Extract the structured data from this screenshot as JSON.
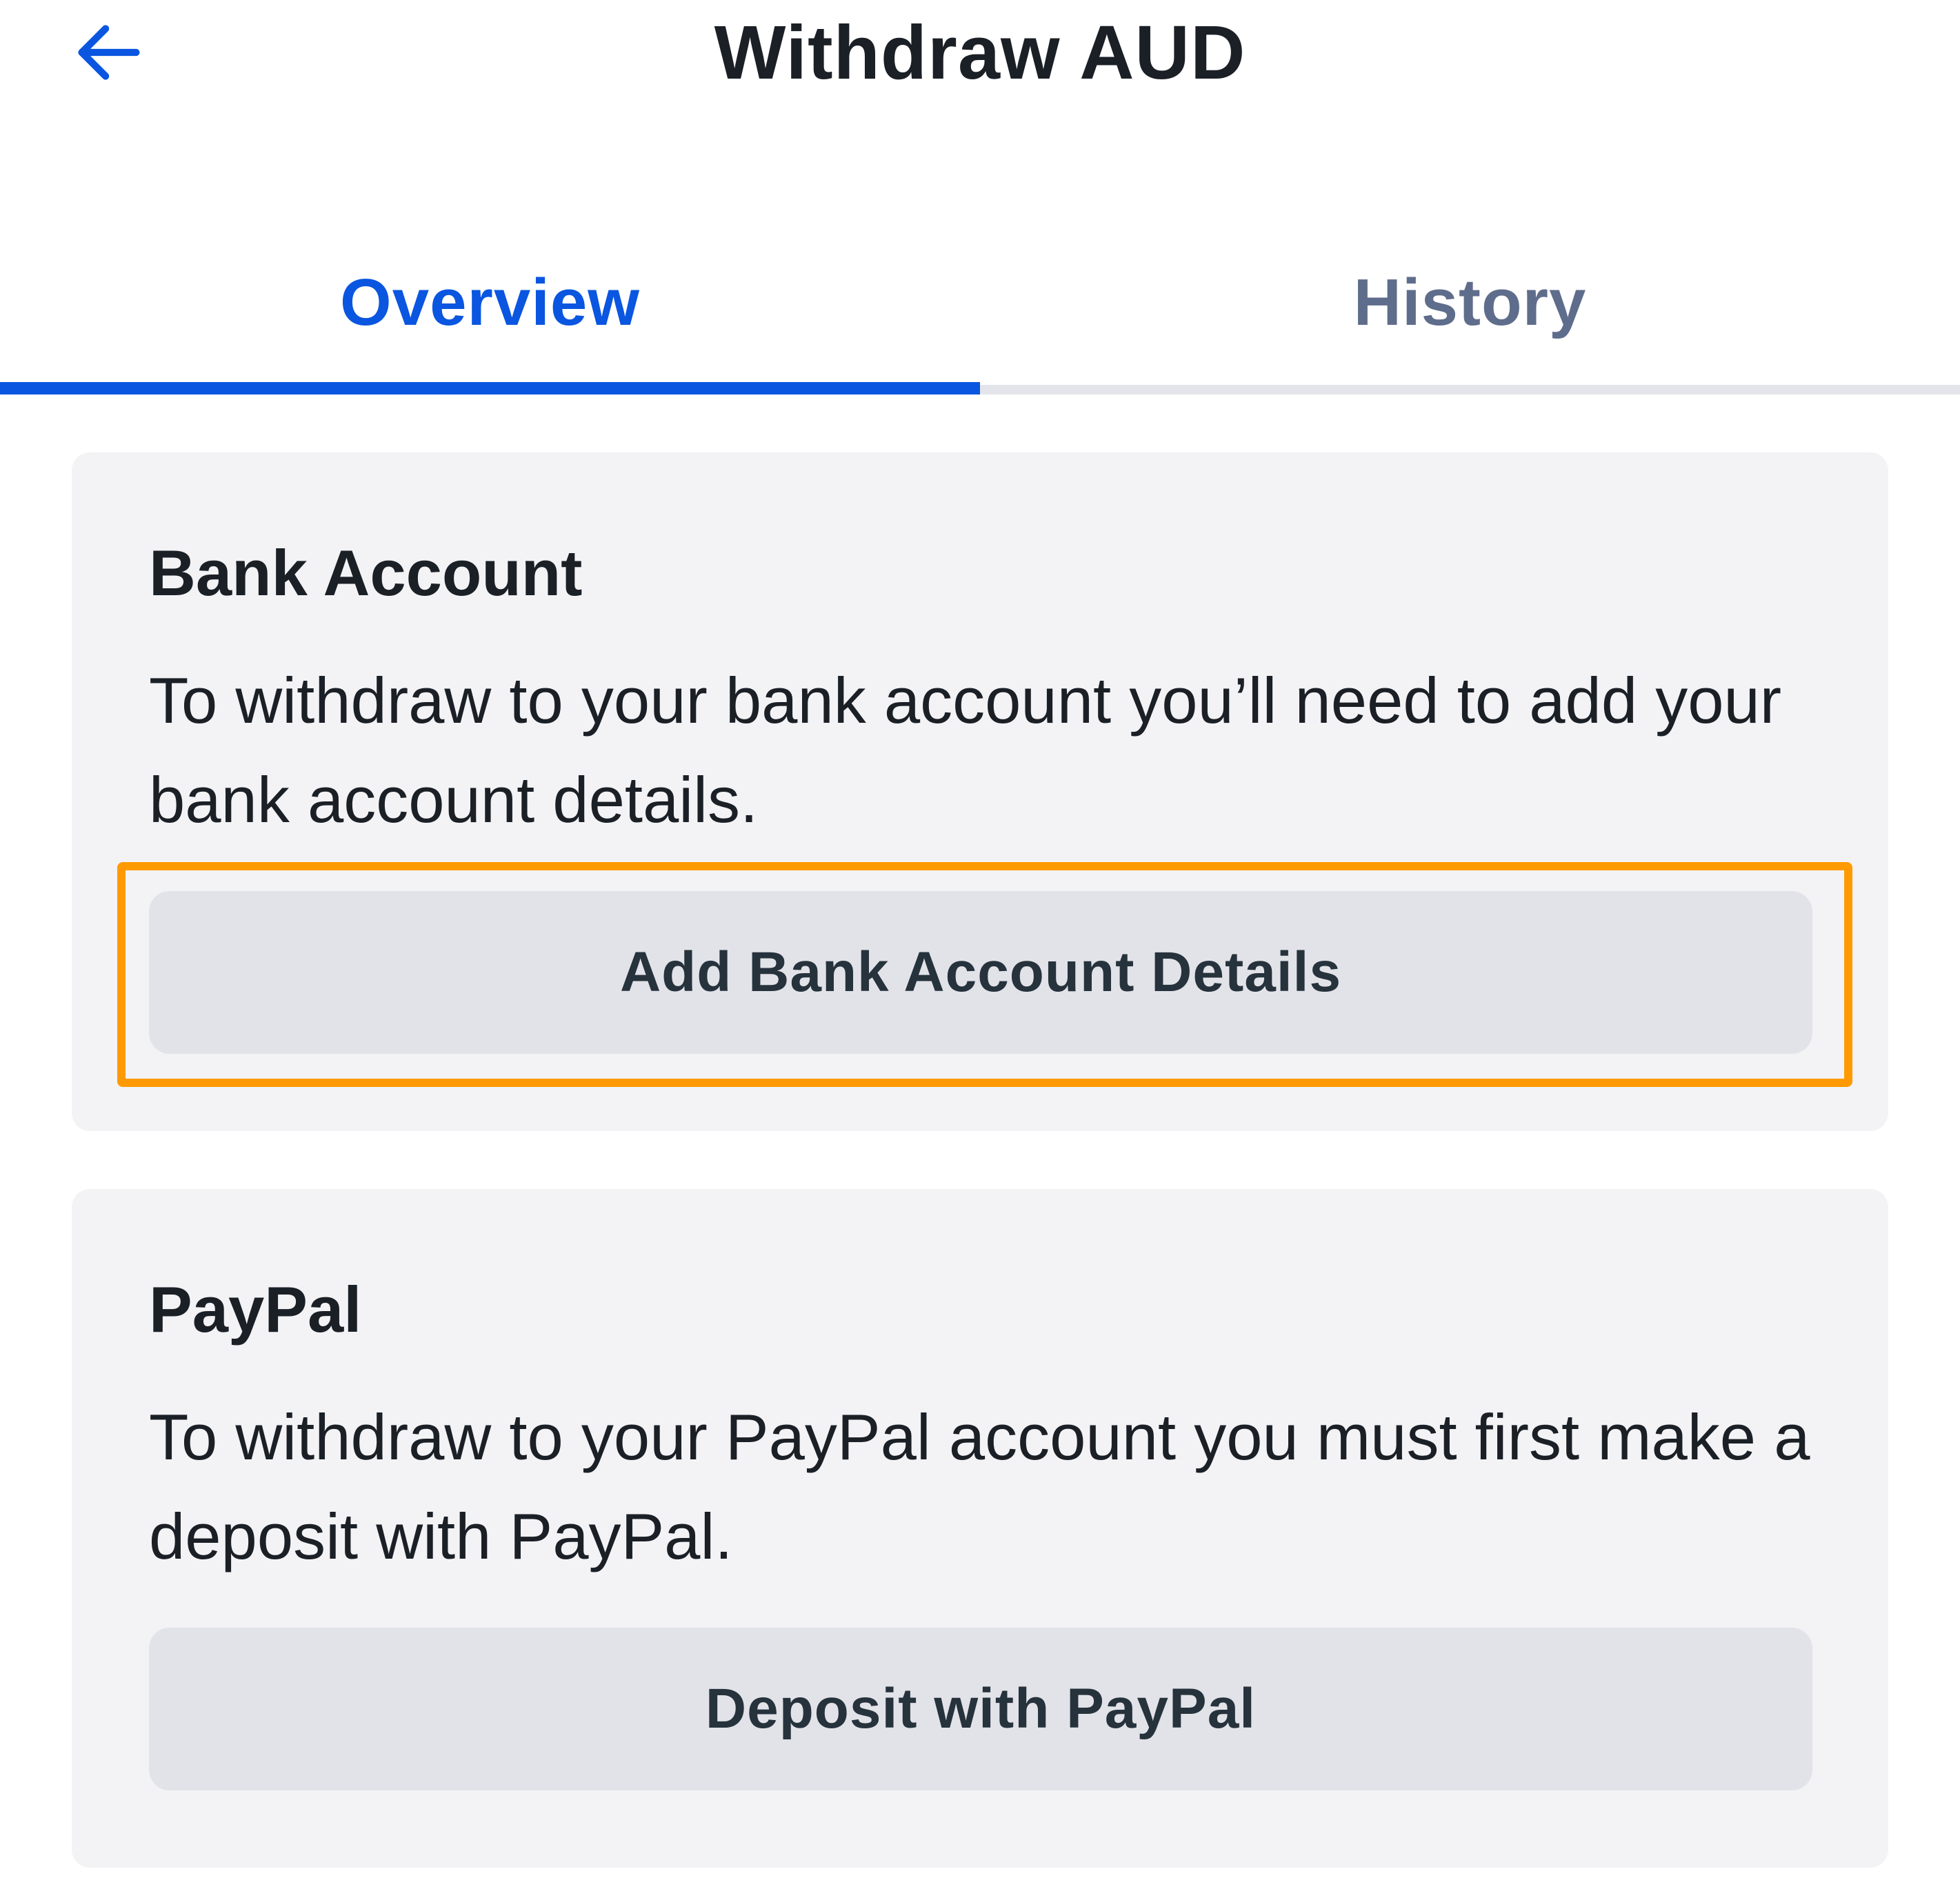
{
  "header": {
    "title": "Withdraw AUD",
    "back_icon": "arrow-left-icon"
  },
  "tabs": [
    {
      "label": "Overview",
      "active": true
    },
    {
      "label": "History",
      "active": false
    }
  ],
  "sections": {
    "bank": {
      "title": "Bank Account",
      "description": "To withdraw to your bank account you’ll need to add your bank account details.",
      "button_label": "Add Bank Account Details"
    },
    "paypal": {
      "title": "PayPal",
      "description": "To withdraw to your PayPal account you must first make a deposit with PayPal.",
      "button_label": "Deposit with PayPal"
    }
  },
  "colors": {
    "accent": "#0a56e0",
    "inactive_tab": "#5f6d8c",
    "card_background": "#f3f3f5",
    "button_background": "#e2e3e8",
    "highlight": "#ff9a00"
  }
}
